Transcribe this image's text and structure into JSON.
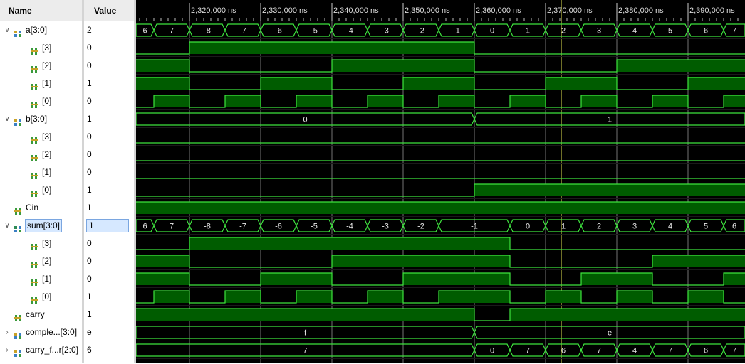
{
  "header": {
    "name_col": "Name",
    "value_col": "Value"
  },
  "timeline": {
    "labels": [
      "2,320,000 ns",
      "2,330,000 ns",
      "2,340,000 ns",
      "2,350,000 ns",
      "2,360,000 ns",
      "2,370,000 ns",
      "2,380,000 ns",
      "2,390,000 ns"
    ]
  },
  "signals": [
    {
      "name": "a[3:0]",
      "value": "2",
      "expand": "expanded",
      "icon": "bus-icon"
    },
    {
      "name": "[3]",
      "value": "0",
      "expand": "none",
      "icon": "bit-icon"
    },
    {
      "name": "[2]",
      "value": "0",
      "expand": "none",
      "icon": "bit-icon"
    },
    {
      "name": "[1]",
      "value": "1",
      "expand": "none",
      "icon": "bit-icon"
    },
    {
      "name": "[0]",
      "value": "0",
      "expand": "none",
      "icon": "bit-icon"
    },
    {
      "name": "b[3:0]",
      "value": "1",
      "expand": "expanded",
      "icon": "bus-icon"
    },
    {
      "name": "[3]",
      "value": "0",
      "expand": "none",
      "icon": "bit-icon"
    },
    {
      "name": "[2]",
      "value": "0",
      "expand": "none",
      "icon": "bit-icon"
    },
    {
      "name": "[1]",
      "value": "0",
      "expand": "none",
      "icon": "bit-icon"
    },
    {
      "name": "[0]",
      "value": "1",
      "expand": "none",
      "icon": "bit-icon"
    },
    {
      "name": "Cin",
      "value": "1",
      "expand": "none",
      "icon": "bit-icon"
    },
    {
      "name": "sum[3:0]",
      "value": "1",
      "expand": "expanded",
      "icon": "bus-icon",
      "selected": true
    },
    {
      "name": "[3]",
      "value": "0",
      "expand": "none",
      "icon": "bit-icon"
    },
    {
      "name": "[2]",
      "value": "0",
      "expand": "none",
      "icon": "bit-icon"
    },
    {
      "name": "[1]",
      "value": "0",
      "expand": "none",
      "icon": "bit-icon"
    },
    {
      "name": "[0]",
      "value": "1",
      "expand": "none",
      "icon": "bit-icon"
    },
    {
      "name": "carry",
      "value": "1",
      "expand": "none",
      "icon": "bit-icon"
    },
    {
      "name": "comple...[3:0]",
      "value": "e",
      "expand": "collapsed",
      "icon": "bus-icon"
    },
    {
      "name": "carry_f...r[2:0]",
      "value": "6",
      "expand": "collapsed",
      "icon": "bus-icon"
    }
  ],
  "waves": [
    {
      "type": "bus",
      "segs": [
        "6",
        "7",
        "-8",
        "-7",
        "-6",
        "-5",
        "-4",
        "-3",
        "-2",
        "-1",
        "0",
        "1",
        "2",
        "3",
        "4",
        "5",
        "6",
        "7"
      ]
    },
    {
      "type": "bit",
      "bits": [
        0,
        0,
        1,
        1,
        1,
        1,
        1,
        1,
        1,
        1,
        0,
        0,
        0,
        0,
        0,
        0,
        0,
        0
      ]
    },
    {
      "type": "bit",
      "bits": [
        1,
        1,
        0,
        0,
        0,
        0,
        1,
        1,
        1,
        1,
        0,
        0,
        0,
        0,
        1,
        1,
        1,
        1
      ]
    },
    {
      "type": "bit",
      "bits": [
        1,
        1,
        0,
        0,
        1,
        1,
        0,
        0,
        1,
        1,
        0,
        0,
        1,
        1,
        0,
        0,
        1,
        1
      ]
    },
    {
      "type": "bit",
      "bits": [
        0,
        1,
        0,
        1,
        0,
        1,
        0,
        1,
        0,
        1,
        0,
        1,
        0,
        1,
        0,
        1,
        0,
        1
      ]
    },
    {
      "type": "bus",
      "segs": [
        "0",
        "0",
        "0",
        "0",
        "0",
        "0",
        "0",
        "0",
        "0",
        "0",
        "1",
        "1",
        "1",
        "1",
        "1",
        "1",
        "1",
        "1"
      ]
    },
    {
      "type": "bit",
      "bits": [
        0,
        0,
        0,
        0,
        0,
        0,
        0,
        0,
        0,
        0,
        0,
        0,
        0,
        0,
        0,
        0,
        0,
        0
      ]
    },
    {
      "type": "bit",
      "bits": [
        0,
        0,
        0,
        0,
        0,
        0,
        0,
        0,
        0,
        0,
        0,
        0,
        0,
        0,
        0,
        0,
        0,
        0
      ]
    },
    {
      "type": "bit",
      "bits": [
        0,
        0,
        0,
        0,
        0,
        0,
        0,
        0,
        0,
        0,
        0,
        0,
        0,
        0,
        0,
        0,
        0,
        0
      ]
    },
    {
      "type": "bit",
      "bits": [
        0,
        0,
        0,
        0,
        0,
        0,
        0,
        0,
        0,
        0,
        1,
        1,
        1,
        1,
        1,
        1,
        1,
        1
      ]
    },
    {
      "type": "bit",
      "bits": [
        1,
        1,
        1,
        1,
        1,
        1,
        1,
        1,
        1,
        1,
        1,
        1,
        1,
        1,
        1,
        1,
        1,
        1
      ]
    },
    {
      "type": "bus",
      "segs": [
        "6",
        "7",
        "-8",
        "-7",
        "-6",
        "-5",
        "-4",
        "-3",
        "-2",
        "-1",
        "-1",
        "0",
        "1",
        "2",
        "3",
        "4",
        "5",
        "6"
      ]
    },
    {
      "type": "bit",
      "bits": [
        0,
        0,
        1,
        1,
        1,
        1,
        1,
        1,
        1,
        1,
        1,
        0,
        0,
        0,
        0,
        0,
        0,
        0
      ]
    },
    {
      "type": "bit",
      "bits": [
        1,
        1,
        0,
        0,
        0,
        0,
        1,
        1,
        1,
        1,
        1,
        0,
        0,
        0,
        0,
        1,
        1,
        1
      ]
    },
    {
      "type": "bit",
      "bits": [
        1,
        1,
        0,
        0,
        1,
        1,
        0,
        0,
        1,
        1,
        1,
        0,
        0,
        1,
        1,
        0,
        0,
        1
      ]
    },
    {
      "type": "bit",
      "bits": [
        0,
        1,
        0,
        1,
        0,
        1,
        0,
        1,
        0,
        1,
        1,
        0,
        1,
        0,
        1,
        0,
        1,
        0
      ]
    },
    {
      "type": "bit",
      "bits": [
        1,
        1,
        1,
        1,
        1,
        1,
        1,
        1,
        1,
        1,
        0,
        1,
        1,
        1,
        1,
        1,
        1,
        1
      ]
    },
    {
      "type": "bus",
      "segs": [
        "f",
        "f",
        "f",
        "f",
        "f",
        "f",
        "f",
        "f",
        "f",
        "f",
        "e",
        "e",
        "e",
        "e",
        "e",
        "e",
        "e",
        "e"
      ]
    },
    {
      "type": "bus",
      "segs": [
        "7",
        "7",
        "7",
        "7",
        "7",
        "7",
        "7",
        "7",
        "7",
        "7",
        "0",
        "7",
        "6",
        "7",
        "4",
        "7",
        "6",
        "7"
      ]
    }
  ],
  "colors": {
    "wave": "#3ee43e",
    "fill": "#005c00",
    "grid": "#d0d0d0",
    "cursor": "#e0e050"
  }
}
